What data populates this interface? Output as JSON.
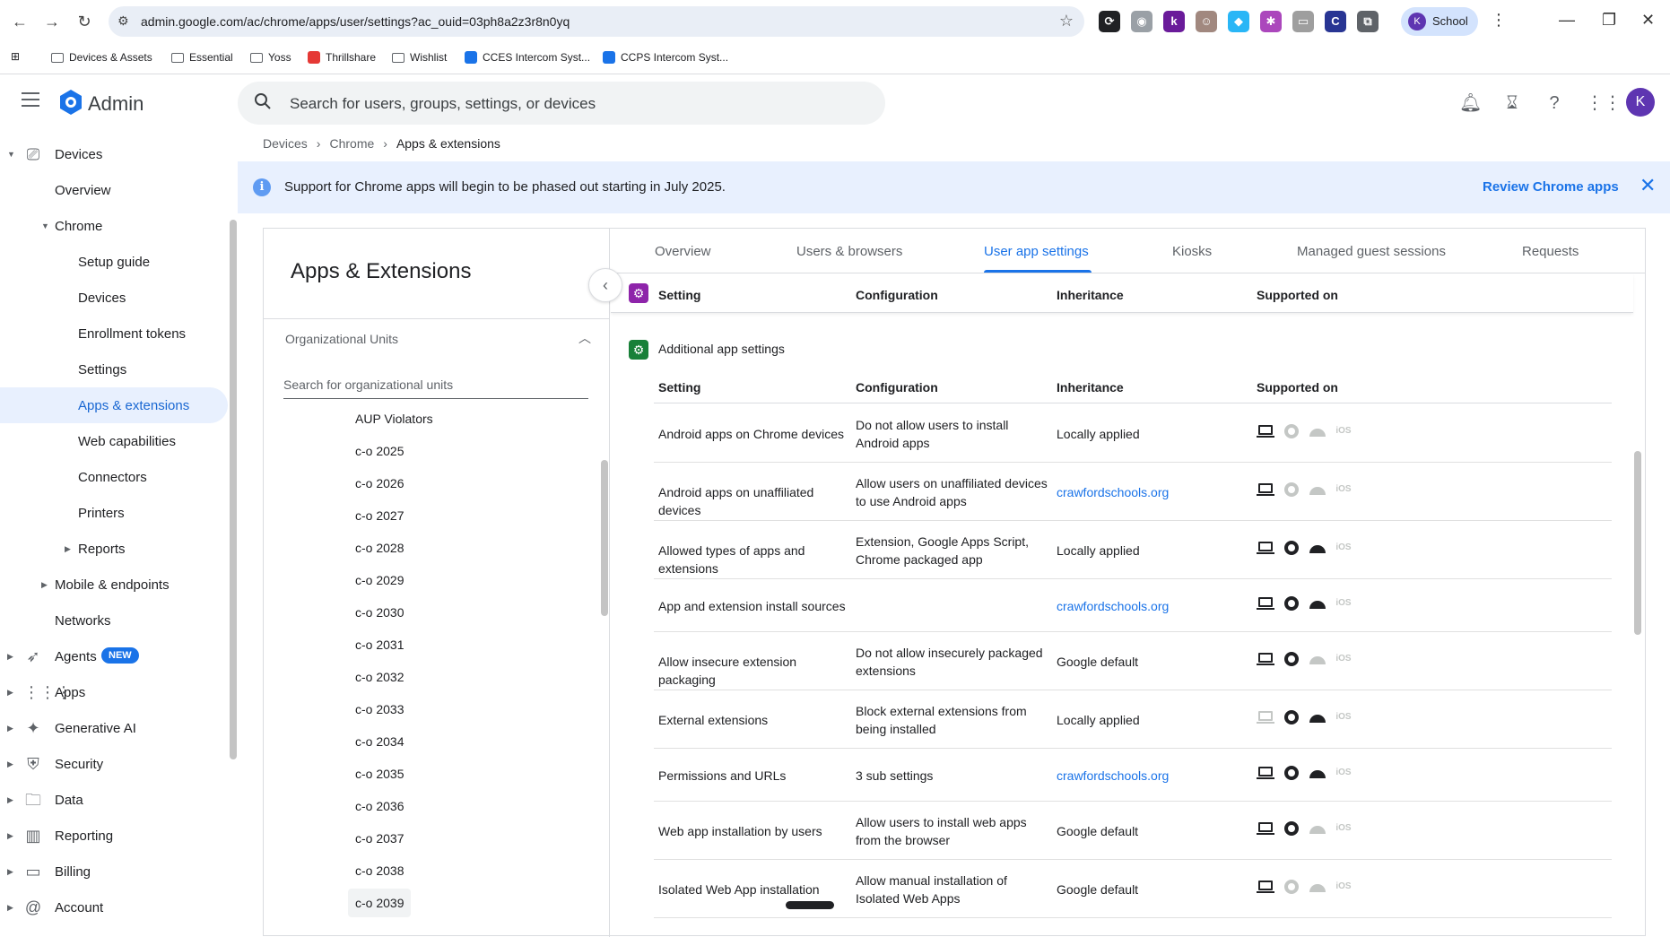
{
  "browser": {
    "url": "admin.google.com/ac/chrome/apps/user/settings?ac_ouid=03ph8a2z3r8n0yq",
    "profile_initial": "K",
    "profile_name": "School",
    "ext_icons": [
      {
        "name": "sync-icon",
        "color": "#202124",
        "glyph": "⟳"
      },
      {
        "name": "camera-icon",
        "color": "#9aa0a6",
        "glyph": "◉"
      },
      {
        "name": "k-extension-icon",
        "color": "#6a1b9a",
        "glyph": "k"
      },
      {
        "name": "avatar-extension-icon",
        "color": "#a1887f",
        "glyph": "☺"
      },
      {
        "name": "diamond-extension-icon",
        "color": "#29b6f6",
        "glyph": "◆"
      },
      {
        "name": "puzzle-purple-icon",
        "color": "#ab47bc",
        "glyph": "✱"
      },
      {
        "name": "cast-icon",
        "color": "#9e9e9e",
        "glyph": "▭"
      },
      {
        "name": "c-extension-icon",
        "color": "#283593",
        "glyph": "C"
      },
      {
        "name": "extensions-puzzle-icon",
        "color": "#5f6368",
        "glyph": "⧉"
      }
    ]
  },
  "bookmarks": [
    {
      "label": "Devices & Assets",
      "type": "folder"
    },
    {
      "label": "Essential",
      "type": "folder"
    },
    {
      "label": "Yoss",
      "type": "folder"
    },
    {
      "label": "Thrillshare",
      "type": "site",
      "color": "#e53935"
    },
    {
      "label": "Wishlist",
      "type": "folder"
    },
    {
      "label": "CCES Intercom Syst...",
      "type": "site",
      "color": "#1a73e8"
    },
    {
      "label": "CCPS Intercom Syst...",
      "type": "site",
      "color": "#1a73e8"
    }
  ],
  "header": {
    "app_title": "Admin",
    "search_placeholder": "Search for users, groups, settings, or devices",
    "avatar_initial": "K"
  },
  "nav": {
    "items": [
      {
        "label": "Devices",
        "level": 0,
        "caret": "open",
        "icon": "devices-icon",
        "glyph": "⎚"
      },
      {
        "label": "Overview",
        "level": 1
      },
      {
        "label": "Chrome",
        "level": 1,
        "caret": "open"
      },
      {
        "label": "Setup guide",
        "level": 2
      },
      {
        "label": "Devices",
        "level": 2
      },
      {
        "label": "Enrollment tokens",
        "level": 2
      },
      {
        "label": "Settings",
        "level": 2
      },
      {
        "label": "Apps & extensions",
        "level": 2,
        "active": true
      },
      {
        "label": "Web capabilities",
        "level": 2
      },
      {
        "label": "Connectors",
        "level": 2
      },
      {
        "label": "Printers",
        "level": 2
      },
      {
        "label": "Reports",
        "level": 2,
        "caret": "closed"
      },
      {
        "label": "Mobile & endpoints",
        "level": 1,
        "caret": "closed"
      },
      {
        "label": "Networks",
        "level": 1
      },
      {
        "label": "Agents",
        "level": 0,
        "caret": "closed",
        "icon": "rocket-icon",
        "glyph": "➶",
        "badge": "NEW"
      },
      {
        "label": "Apps",
        "level": 0,
        "caret": "closed",
        "icon": "apps-grid-icon",
        "glyph": "⋮⋮⋮"
      },
      {
        "label": "Generative AI",
        "level": 0,
        "caret": "closed",
        "icon": "sparkle-icon",
        "glyph": "✦"
      },
      {
        "label": "Security",
        "level": 0,
        "caret": "closed",
        "icon": "shield-icon",
        "glyph": "⛨"
      },
      {
        "label": "Data",
        "level": 0,
        "caret": "closed",
        "icon": "data-folder-icon",
        "glyph": "🗀"
      },
      {
        "label": "Reporting",
        "level": 0,
        "caret": "closed",
        "icon": "bar-chart-icon",
        "glyph": "▥"
      },
      {
        "label": "Billing",
        "level": 0,
        "caret": "closed",
        "icon": "credit-card-icon",
        "glyph": "▭"
      },
      {
        "label": "Account",
        "level": 0,
        "caret": "closed",
        "icon": "account-icon",
        "glyph": "@"
      }
    ]
  },
  "breadcrumb": [
    "Devices",
    "Chrome",
    "Apps & extensions"
  ],
  "banner": {
    "message": "Support for Chrome apps will begin to be phased out starting in July 2025.",
    "action": "Review Chrome apps"
  },
  "org_panel": {
    "title": "Apps & Extensions",
    "section": "Organizational Units",
    "search_placeholder": "Search for organizational units",
    "units": [
      "AUP Violators",
      "c-o 2025",
      "c-o 2026",
      "c-o 2027",
      "c-o 2028",
      "c-o 2029",
      "c-o 2030",
      "c-o 2031",
      "c-o 2032",
      "c-o 2033",
      "c-o 2034",
      "c-o 2035",
      "c-o 2036",
      "c-o 2037",
      "c-o 2038",
      "c-o 2039"
    ],
    "selected_unit": "c-o 2039"
  },
  "tabs": [
    "Overview",
    "Users & browsers",
    "User app settings",
    "Kiosks",
    "Managed guest sessions",
    "Requests"
  ],
  "active_tab": "User app settings",
  "columns": {
    "setting": "Setting",
    "configuration": "Configuration",
    "inheritance": "Inheritance",
    "supported": "Supported on"
  },
  "section_title": "Additional app settings",
  "colors": {
    "purple_badge": "#8e24aa",
    "green_badge": "#188038",
    "accent": "#1a73e8"
  },
  "rows": [
    {
      "setting": "Android apps on Chrome devices",
      "config": "Do not allow users to install Android apps",
      "inheritance": "Locally applied",
      "inherit_link": false,
      "support": [
        true,
        false,
        false,
        false
      ]
    },
    {
      "setting": "Android apps on unaffiliated devices",
      "config": "Allow users on unaffiliated devices to use Android apps",
      "inheritance": "crawfordschools.org",
      "inherit_link": true,
      "support": [
        true,
        false,
        false,
        false
      ]
    },
    {
      "setting": "Allowed types of apps and extensions",
      "config": "Extension, Google Apps Script, Chrome packaged app",
      "inheritance": "Locally applied",
      "inherit_link": false,
      "support": [
        true,
        true,
        true,
        false
      ]
    },
    {
      "setting": "App and extension install sources",
      "config": "",
      "inheritance": "crawfordschools.org",
      "inherit_link": true,
      "support": [
        true,
        true,
        true,
        false
      ]
    },
    {
      "setting": "Allow insecure extension packaging",
      "config": "Do not allow insecurely packaged extensions",
      "inheritance": "Google default",
      "inherit_link": false,
      "support": [
        true,
        true,
        false,
        false
      ]
    },
    {
      "setting": "External extensions",
      "config": "Block external extensions from being installed",
      "inheritance": "Locally applied",
      "inherit_link": false,
      "support": [
        false,
        true,
        true,
        false
      ]
    },
    {
      "setting": "Permissions and URLs",
      "config": "3 sub settings",
      "inheritance": "crawfordschools.org",
      "inherit_link": true,
      "support": [
        true,
        true,
        true,
        false
      ]
    },
    {
      "setting": "Web app installation by users",
      "config": "Allow users to install web apps from the browser",
      "inheritance": "Google default",
      "inherit_link": false,
      "support": [
        true,
        true,
        false,
        false
      ]
    },
    {
      "setting": "Isolated Web App installation",
      "config": "Allow manual installation of Isolated Web Apps",
      "inheritance": "Google default",
      "inherit_link": false,
      "support": [
        true,
        false,
        false,
        false
      ]
    }
  ],
  "ios_label": "iOS"
}
